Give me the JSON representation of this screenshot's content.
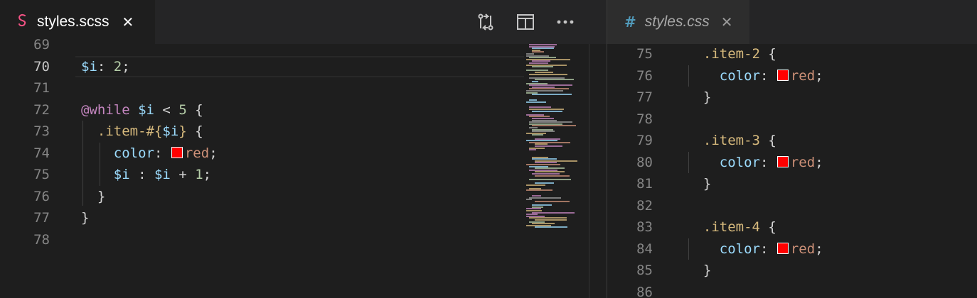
{
  "left_pane": {
    "tab": {
      "label": "styles.scss",
      "icon": "sass-file-icon",
      "icon_color": "#f55385"
    },
    "actions": [
      "open-changes-icon",
      "split-editor-icon",
      "more-actions-icon"
    ],
    "lines": [
      {
        "num": "69",
        "code": []
      },
      {
        "num": "70",
        "active": true,
        "code": [
          {
            "t": "$i",
            "c": "var"
          },
          {
            "t": ": ",
            "c": "punc"
          },
          {
            "t": "2",
            "c": "num"
          },
          {
            "t": ";",
            "c": "punc"
          }
        ]
      },
      {
        "num": "71",
        "code": []
      },
      {
        "num": "72",
        "code": [
          {
            "t": "@while",
            "c": "kw"
          },
          {
            "t": " ",
            "c": "punc"
          },
          {
            "t": "$i",
            "c": "var"
          },
          {
            "t": " < ",
            "c": "punc"
          },
          {
            "t": "5",
            "c": "num"
          },
          {
            "t": " {",
            "c": "punc"
          }
        ]
      },
      {
        "num": "73",
        "code": [
          {
            "t": "  ",
            "c": "punc"
          },
          {
            "t": ".item-#{",
            "c": "sel"
          },
          {
            "t": "$i",
            "c": "var"
          },
          {
            "t": "}",
            "c": "sel"
          },
          {
            "t": " {",
            "c": "punc"
          }
        ]
      },
      {
        "num": "74",
        "code": [
          {
            "t": "    ",
            "c": "punc"
          },
          {
            "t": "color",
            "c": "prop"
          },
          {
            "t": ": ",
            "c": "punc"
          },
          {
            "t": "",
            "c": "swatch"
          },
          {
            "t": "red",
            "c": "val"
          },
          {
            "t": ";",
            "c": "punc"
          }
        ]
      },
      {
        "num": "75",
        "code": [
          {
            "t": "    ",
            "c": "punc"
          },
          {
            "t": "$i",
            "c": "var"
          },
          {
            "t": " : ",
            "c": "punc"
          },
          {
            "t": "$i",
            "c": "var"
          },
          {
            "t": " + ",
            "c": "punc"
          },
          {
            "t": "1",
            "c": "num"
          },
          {
            "t": ";",
            "c": "punc"
          }
        ]
      },
      {
        "num": "76",
        "code": [
          {
            "t": "  }",
            "c": "punc"
          }
        ]
      },
      {
        "num": "77",
        "code": [
          {
            "t": "}",
            "c": "punc"
          }
        ]
      },
      {
        "num": "78",
        "code": []
      }
    ]
  },
  "right_pane": {
    "tab": {
      "label": "styles.css",
      "icon": "css-hash-icon",
      "icon_color": "#519aba"
    },
    "lines": [
      {
        "num": "75",
        "code": [
          {
            "t": "  ",
            "c": "punc"
          },
          {
            "t": ".item-2",
            "c": "sel"
          },
          {
            "t": " {",
            "c": "punc"
          }
        ]
      },
      {
        "num": "76",
        "code": [
          {
            "t": "    ",
            "c": "punc"
          },
          {
            "t": "color",
            "c": "prop"
          },
          {
            "t": ": ",
            "c": "punc"
          },
          {
            "t": "",
            "c": "swatch"
          },
          {
            "t": "red",
            "c": "val"
          },
          {
            "t": ";",
            "c": "punc"
          }
        ]
      },
      {
        "num": "77",
        "code": [
          {
            "t": "  }",
            "c": "punc"
          }
        ]
      },
      {
        "num": "78",
        "code": []
      },
      {
        "num": "79",
        "code": [
          {
            "t": "  ",
            "c": "punc"
          },
          {
            "t": ".item-3",
            "c": "sel"
          },
          {
            "t": " {",
            "c": "punc"
          }
        ]
      },
      {
        "num": "80",
        "code": [
          {
            "t": "    ",
            "c": "punc"
          },
          {
            "t": "color",
            "c": "prop"
          },
          {
            "t": ": ",
            "c": "punc"
          },
          {
            "t": "",
            "c": "swatch"
          },
          {
            "t": "red",
            "c": "val"
          },
          {
            "t": ";",
            "c": "punc"
          }
        ]
      },
      {
        "num": "81",
        "code": [
          {
            "t": "  }",
            "c": "punc"
          }
        ]
      },
      {
        "num": "82",
        "code": []
      },
      {
        "num": "83",
        "code": [
          {
            "t": "  ",
            "c": "punc"
          },
          {
            "t": ".item-4",
            "c": "sel"
          },
          {
            "t": " {",
            "c": "punc"
          }
        ]
      },
      {
        "num": "84",
        "code": [
          {
            "t": "    ",
            "c": "punc"
          },
          {
            "t": "color",
            "c": "prop"
          },
          {
            "t": ": ",
            "c": "punc"
          },
          {
            "t": "",
            "c": "swatch"
          },
          {
            "t": "red",
            "c": "val"
          },
          {
            "t": ";",
            "c": "punc"
          }
        ]
      },
      {
        "num": "85",
        "code": [
          {
            "t": "  }",
            "c": "punc"
          }
        ]
      },
      {
        "num": "86",
        "code": []
      }
    ]
  },
  "colors": {
    "background": "#1e1e1e",
    "tabbar": "#252526",
    "swatch_red": "#ff0000"
  }
}
